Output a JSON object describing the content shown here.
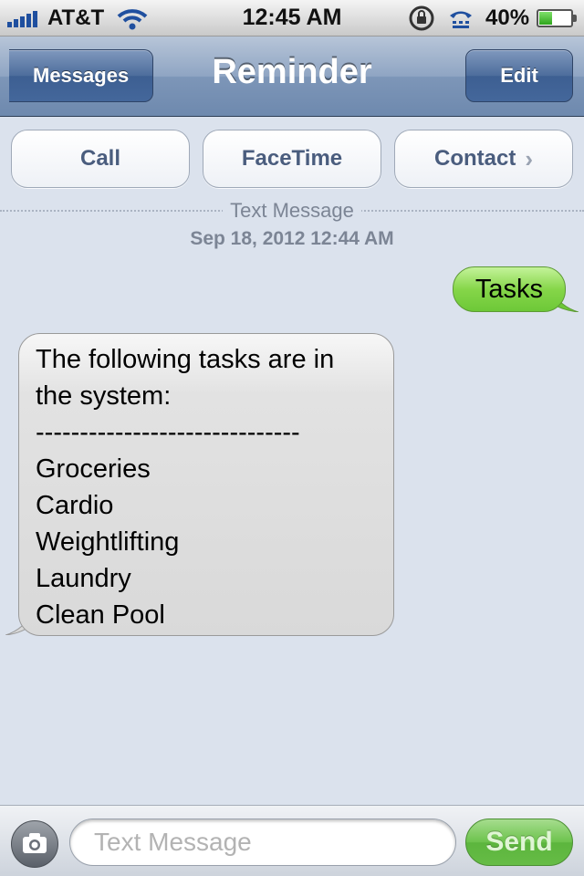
{
  "status_bar": {
    "carrier": "AT&T",
    "time": "12:45 AM",
    "battery_percent": "40%",
    "battery_level": 0.4,
    "icons": [
      "signal-bars-icon",
      "wifi-icon",
      "orientation-lock-icon",
      "tty-icon",
      "battery-icon"
    ]
  },
  "nav_bar": {
    "back_label": "Messages",
    "title": "Reminder",
    "edit_label": "Edit"
  },
  "actions": {
    "call_label": "Call",
    "facetime_label": "FaceTime",
    "contact_label": "Contact"
  },
  "thread": {
    "type_label": "Text Message",
    "date": "Sep 18, 2012 12:44 AM",
    "messages": [
      {
        "direction": "outgoing",
        "lines": [
          "Tasks"
        ]
      },
      {
        "direction": "incoming",
        "lines": [
          "The following tasks are in",
          "the system:",
          "------------------------------",
          "Groceries",
          "Cardio",
          "Weightlifting",
          "Laundry",
          "Clean Pool"
        ]
      }
    ]
  },
  "composer": {
    "placeholder": "Text Message",
    "value": "",
    "send_label": "Send"
  },
  "colors": {
    "outgoing_bubble": "#86d649",
    "incoming_bubble": "#dcdcdc",
    "nav_bar": "#8fa5c3",
    "background": "#dbe2ed",
    "send_button": "#6cc24c"
  }
}
